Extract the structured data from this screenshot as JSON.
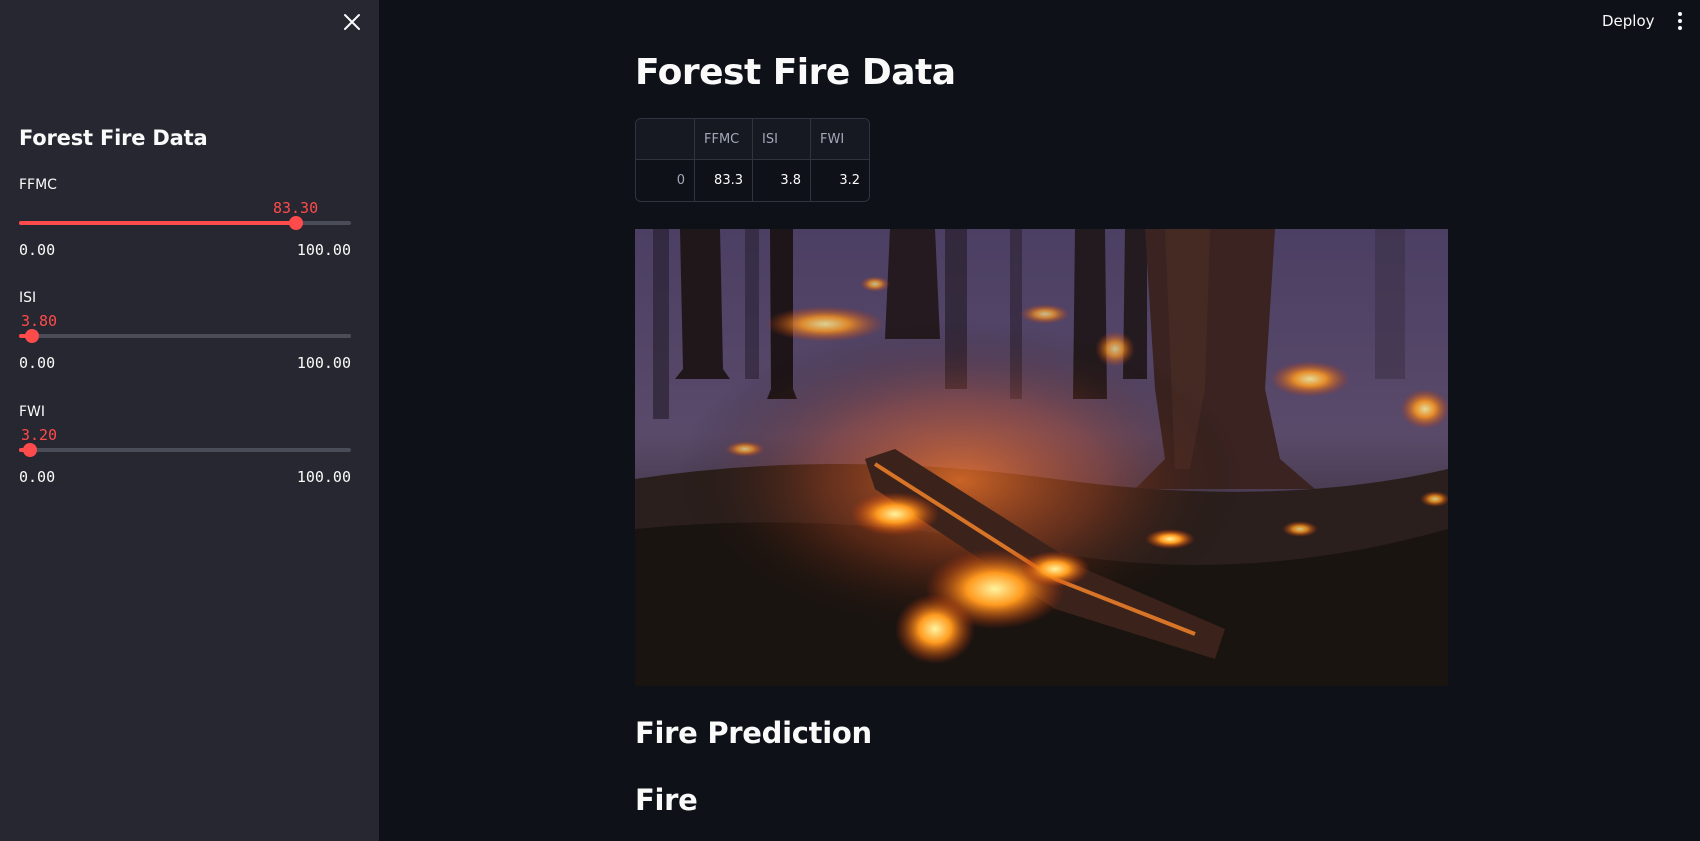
{
  "sidebar": {
    "title": "Forest Fire Data",
    "close_icon": "close-icon",
    "sliders": [
      {
        "label": "FFMC",
        "value": "83.30",
        "min": "0.00",
        "max": "100.00",
        "fraction": 0.833
      },
      {
        "label": "ISI",
        "value": "3.80",
        "min": "0.00",
        "max": "100.00",
        "fraction": 0.038
      },
      {
        "label": "FWI",
        "value": "3.20",
        "min": "0.00",
        "max": "100.00",
        "fraction": 0.032
      }
    ]
  },
  "header": {
    "deploy_label": "Deploy",
    "menu_icon": "more-vertical-icon"
  },
  "main": {
    "title": "Forest Fire Data",
    "table": {
      "columns": [
        "",
        "FFMC",
        "ISI",
        "FWI"
      ],
      "rows": [
        [
          "0",
          "83.3",
          "3.8",
          "3.2"
        ]
      ]
    },
    "image": {
      "subject": "forest-fire-photo"
    },
    "prediction_heading": "Fire Prediction",
    "prediction_result": "Fire"
  },
  "colors": {
    "accent": "#ff4b4b",
    "background": "#0e1117",
    "sidebar": "#262730",
    "text": "#fafafa"
  }
}
